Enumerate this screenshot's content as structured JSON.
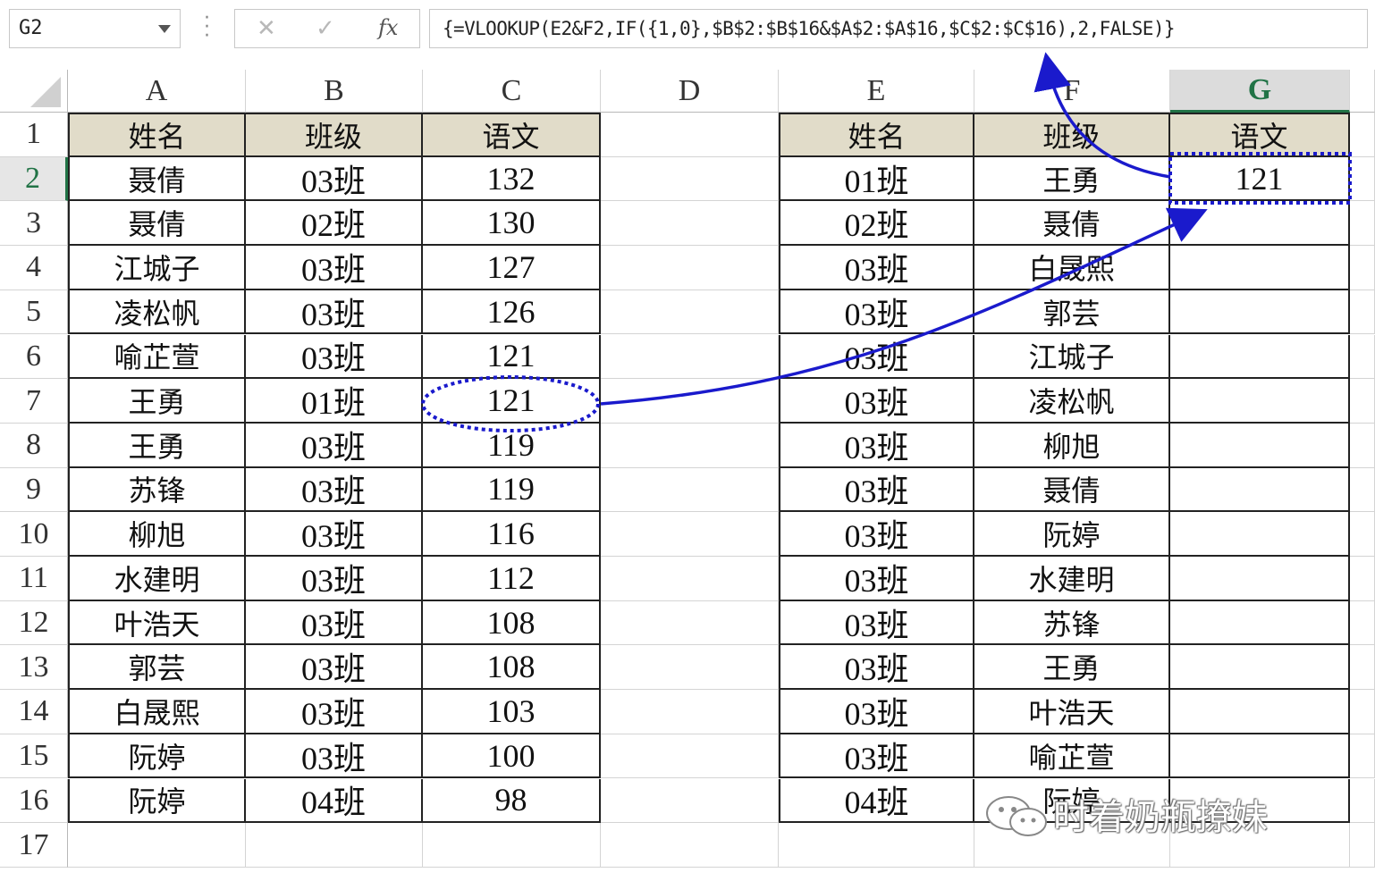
{
  "name_box": "G2",
  "formula_buttons": {
    "cancel": "✕",
    "enter": "✓",
    "fx": "fx"
  },
  "formula": "{=VLOOKUP(E2&F2,IF({1,0},$B$2:$B$16&$A$2:$A$16,$C$2:$C$16),2,FALSE)}",
  "columns": [
    "A",
    "B",
    "C",
    "D",
    "E",
    "F",
    "G"
  ],
  "rows": [
    "1",
    "2",
    "3",
    "4",
    "5",
    "6",
    "7",
    "8",
    "9",
    "10",
    "11",
    "12",
    "13",
    "14",
    "15",
    "16",
    "17"
  ],
  "selected_cell": {
    "col": "G",
    "row": "2"
  },
  "left_table": {
    "headers": [
      "姓名",
      "班级",
      "语文"
    ],
    "rows": [
      [
        "聂倩",
        "03班",
        "132"
      ],
      [
        "聂倩",
        "02班",
        "130"
      ],
      [
        "江城子",
        "03班",
        "127"
      ],
      [
        "凌松帆",
        "03班",
        "126"
      ],
      [
        "喻芷萱",
        "03班",
        "121"
      ],
      [
        "王勇",
        "01班",
        "121"
      ],
      [
        "王勇",
        "03班",
        "119"
      ],
      [
        "苏锋",
        "03班",
        "119"
      ],
      [
        "柳旭",
        "03班",
        "116"
      ],
      [
        "水建明",
        "03班",
        "112"
      ],
      [
        "叶浩天",
        "03班",
        "108"
      ],
      [
        "郭芸",
        "03班",
        "108"
      ],
      [
        "白晟熙",
        "03班",
        "103"
      ],
      [
        "阮婷",
        "03班",
        "100"
      ],
      [
        "阮婷",
        "04班",
        "98"
      ]
    ]
  },
  "right_table": {
    "headers": [
      "姓名",
      "班级",
      "语文"
    ],
    "rows": [
      [
        "01班",
        "王勇",
        "121"
      ],
      [
        "02班",
        "聂倩",
        ""
      ],
      [
        "03班",
        "白晟熙",
        ""
      ],
      [
        "03班",
        "郭芸",
        ""
      ],
      [
        "03班",
        "江城子",
        ""
      ],
      [
        "03班",
        "凌松帆",
        ""
      ],
      [
        "03班",
        "柳旭",
        ""
      ],
      [
        "03班",
        "聂倩",
        ""
      ],
      [
        "03班",
        "阮婷",
        ""
      ],
      [
        "03班",
        "水建明",
        ""
      ],
      [
        "03班",
        "苏锋",
        ""
      ],
      [
        "03班",
        "王勇",
        ""
      ],
      [
        "03班",
        "叶浩天",
        ""
      ],
      [
        "03班",
        "喻芷萱",
        ""
      ],
      [
        "04班",
        "阮婷",
        ""
      ]
    ]
  },
  "annotation_color": "#1a1acc",
  "watermark": "时着奶瓶撩妹"
}
